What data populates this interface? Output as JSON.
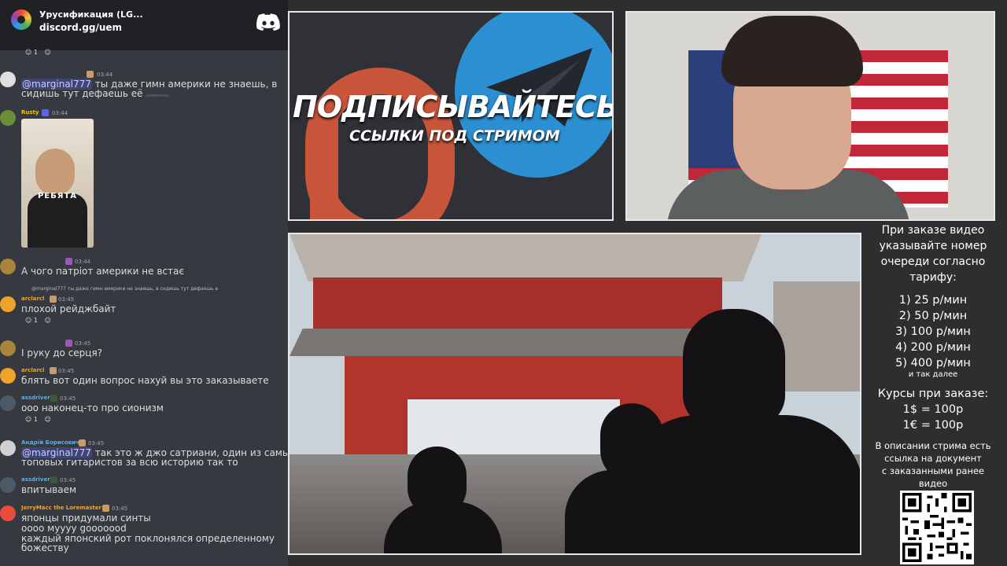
{
  "discord": {
    "server_name": "Урусификация (LG...",
    "invite": "discord.gg/uem",
    "messages": [
      {
        "author": "",
        "time": "03:44",
        "text_mention": "@marginal777",
        "text": " ты даже гимн америки не знаешь, в",
        "text2": "сидишь тут дефаешь её",
        "edited": "(изменено)"
      },
      {
        "author": "Rusty",
        "time": "03:44",
        "image_caption": "РЕБЯТА"
      },
      {
        "author": "",
        "time": "03:44",
        "text": "А чого патріот америки не встає"
      },
      {
        "reply": "@marginal777 ты даже гимн америки не знаешь, в сидишь тут дефаешь е",
        "author": "arclarcl",
        "time": "03:45",
        "text": "плохой рейджбайт",
        "reaction_count": "1"
      },
      {
        "author": "",
        "time": "03:45",
        "text": "І руку до серця?"
      },
      {
        "author": "arclarcl",
        "time": "03:45",
        "text": "блять вот один вопрос нахуй вы это заказываете"
      },
      {
        "author": "assdriver",
        "time": "03:45",
        "text": "ооо наконец-то про сионизм",
        "reaction_count": "1"
      },
      {
        "author": "Андрій Борисович",
        "time": "03:45",
        "text_mention": "@marginal777",
        "text": " так это ж джо сатриани, один из самых",
        "text2": "топовых гитаристов за всю историю так то"
      },
      {
        "author": "assdriver",
        "time": "03:45",
        "text": "впитываем"
      },
      {
        "author": "JerryMacc the Loremaster",
        "time": "03:45",
        "text": "японцы придумали синты",
        "text2": "оооо муууу gooooood",
        "text3": "каждый японский рот поклонялся определенному",
        "text4": "божеству"
      }
    ],
    "top_reaction_count": "1"
  },
  "banner": {
    "title": "ПОДПИСЫВАЙТЕСЬ",
    "subtitle": "ССЫЛКИ ПОД СТРИМОМ"
  },
  "info": {
    "intro": [
      "При заказе видео",
      "указывайте номер",
      "очереди согласно",
      "тарифу:"
    ],
    "tariffs": [
      "1) 25 р/мин",
      "2) 50 р/мин",
      "3) 100 р/мин",
      "4) 200 р/мин",
      "5) 400 р/мин"
    ],
    "etc": "и так далее",
    "rates_title": "Курсы при заказе:",
    "rates": [
      "1$ = 100р",
      "1€ = 100р"
    ],
    "desc": [
      "В описании стрима есть",
      "ссылка на документ",
      "с заказанными ранее",
      "видео"
    ]
  },
  "colors": {
    "discord_bg": "#36393f",
    "mention_bg": "#5865f2",
    "telegram_blue": "#2b8fd1",
    "patreon_orange": "#c8543a"
  },
  "icons": [
    "discord-logo-icon",
    "patreon-icon",
    "telegram-icon",
    "qr-code"
  ]
}
